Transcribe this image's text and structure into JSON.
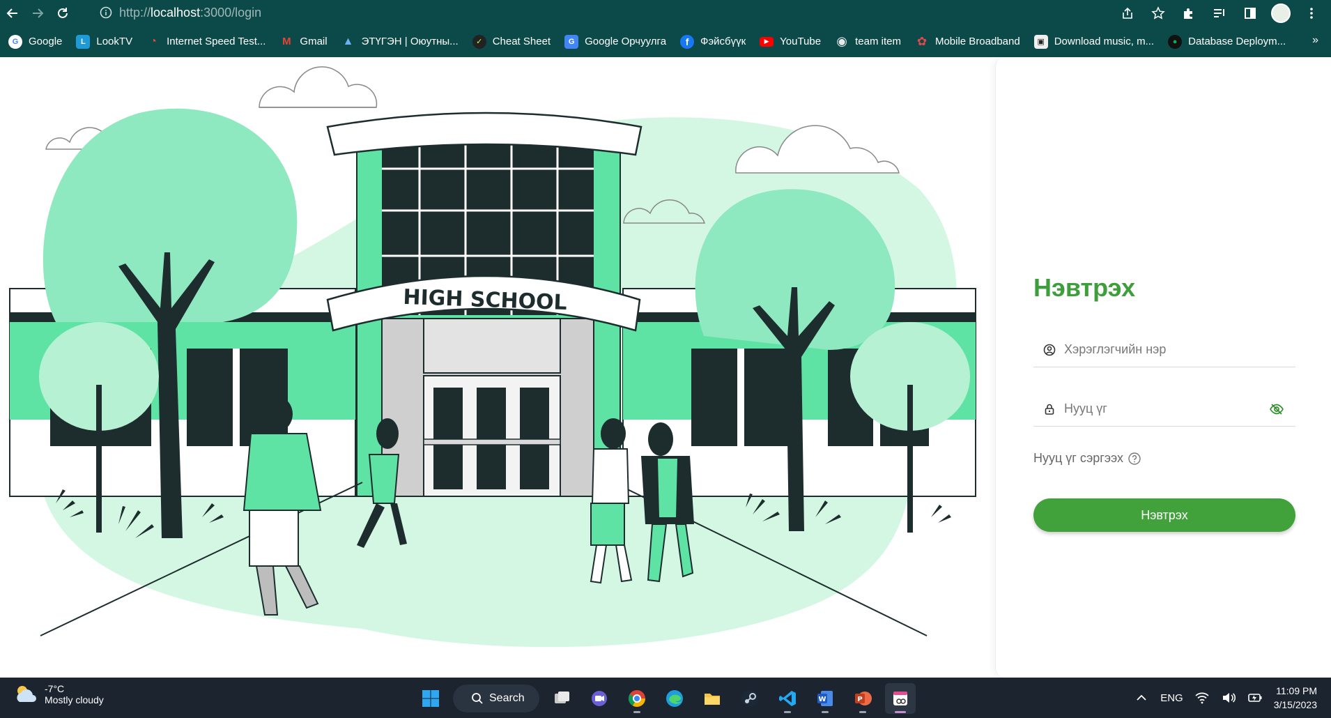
{
  "browser": {
    "url_prefix": "http://",
    "url_host": "localhost",
    "url_path": ":3000/login"
  },
  "bookmarks": [
    {
      "label": "Google",
      "color": "#ffffff",
      "glyph": "G"
    },
    {
      "label": "LookTV",
      "color": "#1e9ad6",
      "glyph": "L"
    },
    {
      "label": "Internet Speed Test...",
      "color": "#c0392b",
      "glyph": "◔"
    },
    {
      "label": "Gmail",
      "color": "#ea4335",
      "glyph": "M"
    },
    {
      "label": "ЭТҮГЭН | Оюутны...",
      "color": "#3a8fd8",
      "glyph": "▲"
    },
    {
      "label": "Cheat Sheet",
      "color": "#222222",
      "glyph": "✓"
    },
    {
      "label": "Google Орчуулга",
      "color": "#4285f4",
      "glyph": "G"
    },
    {
      "label": "Фэйсбүүк",
      "color": "#1877f2",
      "glyph": "f"
    },
    {
      "label": "YouTube",
      "color": "#ff0000",
      "glyph": "▶"
    },
    {
      "label": "team item",
      "color": "#e9e9e9",
      "glyph": "◉"
    },
    {
      "label": "Mobile Broadband",
      "color": "#e5484d",
      "glyph": "✿"
    },
    {
      "label": "Download music, m...",
      "color": "#f0f0f0",
      "glyph": "▣"
    },
    {
      "label": "Database Deploym...",
      "color": "#13aa52",
      "glyph": "●"
    }
  ],
  "login": {
    "title": "Нэвтрэх",
    "username_placeholder": "Хэрэглэгчийн нэр",
    "password_placeholder": "Нууц үг",
    "forgot_label": "Нууц үг сэргээх",
    "submit_label": "Нэвтрэх"
  },
  "illustration": {
    "sign_text": "HIGH SCHOOL"
  },
  "taskbar": {
    "temperature": "-7°C",
    "condition": "Mostly cloudy",
    "search_label": "Search",
    "language": "ENG",
    "time": "11:09 PM",
    "date": "3/15/2023"
  },
  "colors": {
    "chrome": "#0c4a4a",
    "accent": "#41a23b",
    "mint": "#5ee3a5",
    "mint_light": "#d4f7e4",
    "dark": "#1d2d2e"
  }
}
